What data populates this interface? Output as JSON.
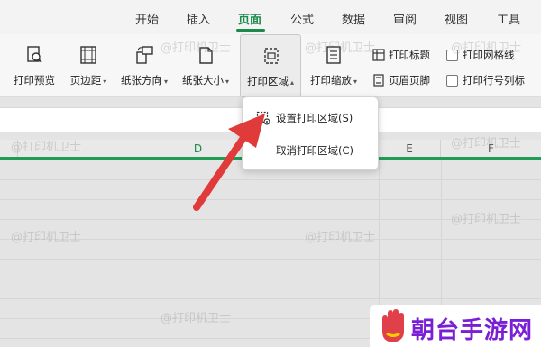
{
  "tabs": [
    {
      "label": "开始",
      "active": false
    },
    {
      "label": "插入",
      "active": false
    },
    {
      "label": "页面",
      "active": true
    },
    {
      "label": "公式",
      "active": false
    },
    {
      "label": "数据",
      "active": false
    },
    {
      "label": "审阅",
      "active": false
    },
    {
      "label": "视图",
      "active": false
    },
    {
      "label": "工具",
      "active": false
    }
  ],
  "ribbon": {
    "print_preview": "打印预览",
    "margins": "页边距",
    "orientation": "纸张方向",
    "paper_size": "纸张大小",
    "print_area": "打印区域",
    "print_scale": "打印缩放",
    "print_titles": "打印标题",
    "header_footer": "页眉页脚",
    "print_gridlines": "打印网格线",
    "print_row_col_headers": "打印行号列标"
  },
  "columns": {
    "d": "D",
    "e": "E",
    "f": "F"
  },
  "dropdown": {
    "set_print_area": "设置打印区域(S)",
    "cancel_print_area": "取消打印区域(C)"
  },
  "watermark": "@打印机卫士",
  "logo": {
    "text": "朝台手游网"
  },
  "colors": {
    "accent": "#1b8a4a",
    "arrow": "#e03a3a",
    "logo": "#7a1fd6"
  }
}
